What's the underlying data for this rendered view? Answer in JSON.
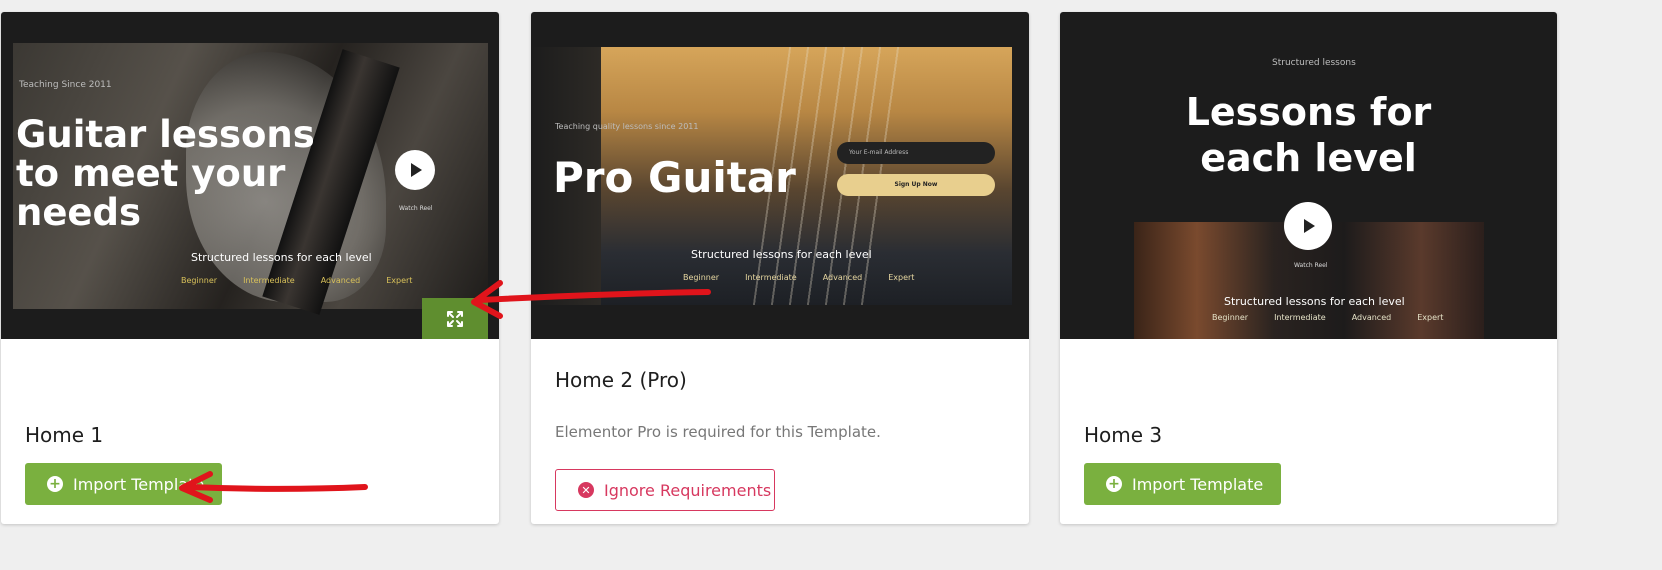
{
  "templates": [
    {
      "name": "Home 1",
      "preview": {
        "eyebrow": "Teaching Since 2011",
        "headline_lines": [
          "Guitar lessons",
          "to meet your",
          "needs"
        ],
        "play_label": "Watch Reel",
        "subheading": "Structured lessons for each level",
        "levels": [
          "Beginner",
          "Intermediate",
          "Advanced",
          "Expert"
        ]
      },
      "expand_icon": "expand-arrows-icon",
      "action_label": "Import Template",
      "action_icon": "plus-circle-icon"
    },
    {
      "name": "Home 2 (Pro)",
      "preview": {
        "eyebrow": "Teaching quality lessons since 2011",
        "headline_lines": [
          "Pro Guitar"
        ],
        "email_placeholder": "Your E-mail Address",
        "signup_label": "Sign Up Now",
        "subheading": "Structured lessons for each level",
        "levels": [
          "Beginner",
          "Intermediate",
          "Advanced",
          "Expert"
        ]
      },
      "requirement_text": "Elementor Pro is required for this Template.",
      "action_label": "Ignore Requirements",
      "action_icon": "x-circle-icon"
    },
    {
      "name": "Home 3",
      "preview": {
        "eyebrow": "Structured lessons",
        "headline_lines": [
          "Lessons for",
          "each level"
        ],
        "play_label": "Watch Reel",
        "subheading": "Structured lessons for each level",
        "levels": [
          "Beginner",
          "Intermediate",
          "Advanced",
          "Expert"
        ]
      },
      "action_label": "Import Template",
      "action_icon": "plus-circle-icon"
    }
  ],
  "colors": {
    "import_green": "#7ab03f",
    "expand_green": "#5f8e2f",
    "ignore_red": "#d7385f",
    "level_gold_home1": "#d8c15a",
    "level_gold_home2": "#e6d6a0",
    "level_gold_home3": "#e6e3c8",
    "annotation_red": "#e0141b"
  }
}
